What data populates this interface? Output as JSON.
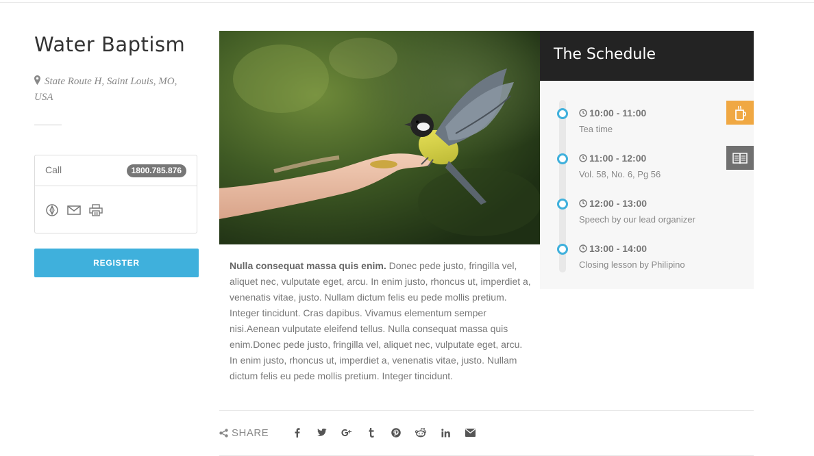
{
  "event": {
    "title": "Water Baptism",
    "location": "State Route H, Saint Louis, MO, USA"
  },
  "contact": {
    "call_label": "Call",
    "phone": "1800.785.876",
    "icons": [
      "website-icon",
      "mail-icon",
      "print-icon"
    ]
  },
  "register_label": "REGISTER",
  "description": {
    "lead": "Nulla consequat massa quis enim.",
    "text": " Donec pede justo, fringilla vel, aliquet nec, vulputate eget, arcu. In enim justo, rhoncus ut, imperdiet a, venenatis vitae, justo. Nullam dictum felis eu pede mollis pretium. Integer tincidunt. Cras dapibus. Vivamus elementum semper nisi.Aenean vulputate eleifend tellus. Nulla consequat massa quis enim.Donec pede justo, fringilla vel, aliquet nec, vulputate eget, arcu. In enim justo, rhoncus ut, imperdiet a, venenatis vitae, justo. Nullam dictum felis eu pede mollis pretium. Integer tincidunt."
  },
  "schedule": {
    "title": "The Schedule",
    "items": [
      {
        "time": "10:00 - 11:00",
        "desc": "Tea time",
        "badge_icon": "coffee-cup-icon",
        "badge_color": "#f0a843"
      },
      {
        "time": "11:00 - 12:00",
        "desc": "Vol. 58, No. 6, Pg 56",
        "badge_icon": "book-icon",
        "badge_color": "#707070"
      },
      {
        "time": "12:00 - 13:00",
        "desc": "Speech by our lead organizer"
      },
      {
        "time": "13:00 - 14:00",
        "desc": "Closing lesson by Philipino"
      }
    ]
  },
  "share": {
    "label": "SHARE",
    "networks": [
      "facebook-icon",
      "twitter-icon",
      "google-plus-icon",
      "tumblr-icon",
      "pinterest-icon",
      "reddit-icon",
      "linkedin-icon",
      "email-icon"
    ]
  },
  "colors": {
    "accent": "#3fb0dc",
    "dark": "#232323",
    "badge_grey": "#777777"
  }
}
